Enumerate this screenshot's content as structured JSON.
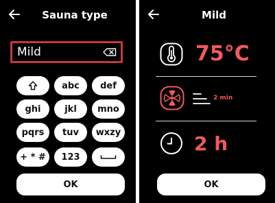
{
  "left_screen": {
    "title": "Sauna type",
    "back_icon": "arrow-left-icon",
    "field": {
      "value": "Mild",
      "clear_icon": "backspace-icon"
    },
    "keys": [
      {
        "label": "",
        "icon": "shift-arrow-icon"
      },
      {
        "label": "abc"
      },
      {
        "label": "def"
      },
      {
        "label": "ghi"
      },
      {
        "label": "jkl"
      },
      {
        "label": "mno"
      },
      {
        "label": "pqrs"
      },
      {
        "label": "tuv"
      },
      {
        "label": "wxzy"
      },
      {
        "label": "+ * #"
      },
      {
        "label": "123"
      },
      {
        "label": "",
        "icon": "space-bar-icon"
      }
    ],
    "ok_label": "OK"
  },
  "right_screen": {
    "title": "Mild",
    "back_icon": "arrow-left-icon",
    "temperature": {
      "icon": "thermometer-icon",
      "value": "75°C"
    },
    "fan": {
      "icon": "fan-icon",
      "level_icon": "fan-level-lines-icon",
      "duration": "2 min"
    },
    "timer": {
      "icon": "clock-icon",
      "value": "2 h"
    },
    "ok_label": "OK"
  },
  "colors": {
    "accent": "#f0595d",
    "field_border": "#c7383e",
    "background": "#000000",
    "key_background": "#ffffff"
  }
}
